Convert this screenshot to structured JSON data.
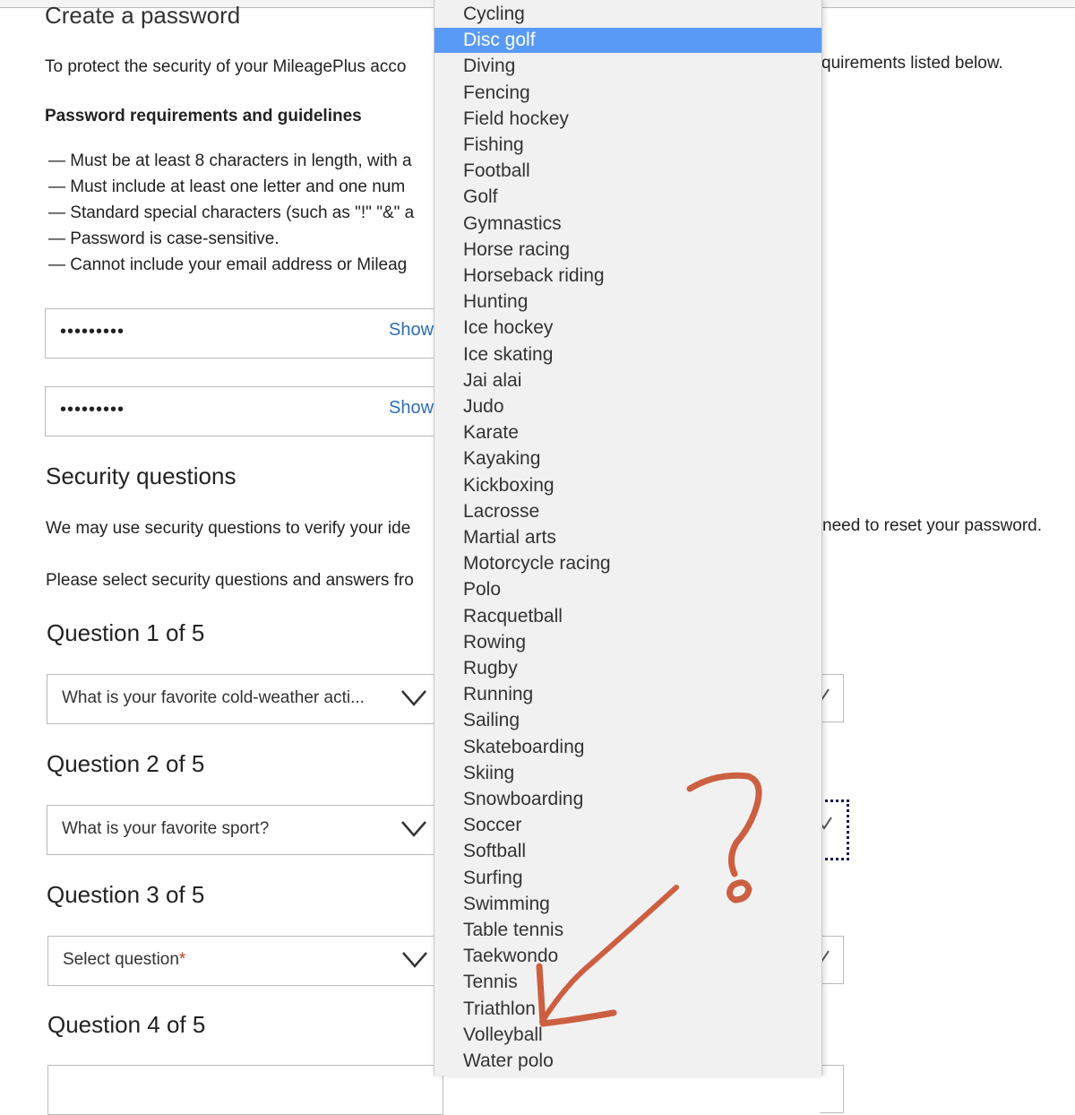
{
  "page": {
    "title": "Create a password",
    "intro_left": "To protect the security of your MileagePlus acco",
    "intro_right": "quirements listed below.",
    "requirements_heading": "Password requirements and guidelines",
    "requirements": [
      "— Must be at least 8 characters in length, with a",
      "— Must include at least one letter and one num",
      "— Standard special characters (such as \"!\" \"&\" a",
      "— Password is case-sensitive.",
      "— Cannot include your email address or Mileag"
    ],
    "password_field": {
      "value": "•••••••••",
      "show_label": "Show"
    },
    "confirm_field": {
      "value": "•••••••••",
      "show_label": "Show"
    },
    "security_heading": "Security questions",
    "security_intro_left": "We may use security questions to verify your ide",
    "security_intro_right": "need to reset your password.",
    "select_intro": "Please select security questions and answers fro",
    "questions": [
      {
        "heading": "Question 1 of 5",
        "value": "What is your favorite cold-weather acti..."
      },
      {
        "heading": "Question 2 of 5",
        "value": "What is your favorite sport?"
      },
      {
        "heading": "Question 3 of 5",
        "value": "Select question",
        "required_mark": "*"
      },
      {
        "heading": "Question 4 of 5"
      }
    ]
  },
  "dropdown": {
    "selected": "Disc golf",
    "options": [
      "Cycling",
      "Disc golf",
      "Diving",
      "Fencing",
      "Field hockey",
      "Fishing",
      "Football",
      "Golf",
      "Gymnastics",
      "Horse racing",
      "Horseback riding",
      "Hunting",
      "Ice hockey",
      "Ice skating",
      "Jai alai",
      "Judo",
      "Karate",
      "Kayaking",
      "Kickboxing",
      "Lacrosse",
      "Martial arts",
      "Motorcycle racing",
      "Polo",
      "Racquetball",
      "Rowing",
      "Rugby",
      "Running",
      "Sailing",
      "Skateboarding",
      "Skiing",
      "Snowboarding",
      "Soccer",
      "Softball",
      "Surfing",
      "Swimming",
      "Table tennis",
      "Taekwondo",
      "Tennis",
      "Triathlon",
      "Volleyball",
      "Water polo"
    ]
  },
  "annotation": {
    "symbol": "?",
    "color": "#c8502e"
  },
  "colors": {
    "highlight": "#5a9af7",
    "link": "#2f6db5",
    "required": "#c0392b"
  }
}
